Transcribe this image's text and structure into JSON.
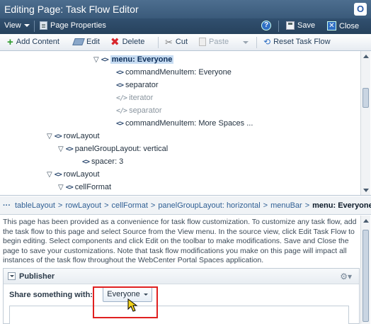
{
  "window": {
    "title": "Editing Page: Task Flow Editor",
    "logo_glyph": "O"
  },
  "header": {
    "view_label": "View",
    "page_properties_label": "Page Properties",
    "help_glyph": "?",
    "save_label": "Save",
    "close_label": "Close"
  },
  "toolbar": {
    "add_content_label": "Add Content",
    "edit_label": "Edit",
    "delete_label": "Delete",
    "cut_label": "Cut",
    "paste_label": "Paste",
    "reset_label": "Reset Task Flow"
  },
  "tree": {
    "nodes": [
      {
        "label": "menu: Everyone",
        "selected": true,
        "disabled": false
      },
      {
        "label": "commandMenuItem: Everyone",
        "selected": false,
        "disabled": false
      },
      {
        "label": "separator",
        "selected": false,
        "disabled": false
      },
      {
        "label": "iterator",
        "selected": false,
        "disabled": true
      },
      {
        "label": "separator",
        "selected": false,
        "disabled": true
      },
      {
        "label": "commandMenuItem: More Spaces ...",
        "selected": false,
        "disabled": false
      },
      {
        "label": "rowLayout",
        "selected": false,
        "disabled": false
      },
      {
        "label": "panelGroupLayout: vertical",
        "selected": false,
        "disabled": false
      },
      {
        "label": "spacer: 3",
        "selected": false,
        "disabled": false
      },
      {
        "label": "rowLayout",
        "selected": false,
        "disabled": false
      },
      {
        "label": "cellFormat",
        "selected": false,
        "disabled": false
      }
    ]
  },
  "breadcrumb": {
    "ellipsis": "···",
    "items": [
      "tableLayout",
      "rowLayout",
      "cellFormat",
      "panelGroupLayout: horizontal",
      "menuBar",
      "menu: Everyone"
    ],
    "separator": ">"
  },
  "info_text": "This page has been provided as a convenience for task flow customization. To customize any task flow, add the task flow to this page and select Source from the View menu. In the source view, click Edit Task Flow to begin editing. Select components and click Edit on the toolbar to make modifications. Save and Close the page to save your customizations. Note that task flow modifications you make on this page will impact all instances of the task flow throughout the WebCenter Portal Spaces application.",
  "publisher": {
    "title": "Publisher",
    "share_label": "Share something with:",
    "share_value": "Everyone"
  },
  "colors": {
    "title_bar": "#3a5a7a",
    "highlight": "#e02020",
    "selected_node": "#c7dcf2"
  }
}
